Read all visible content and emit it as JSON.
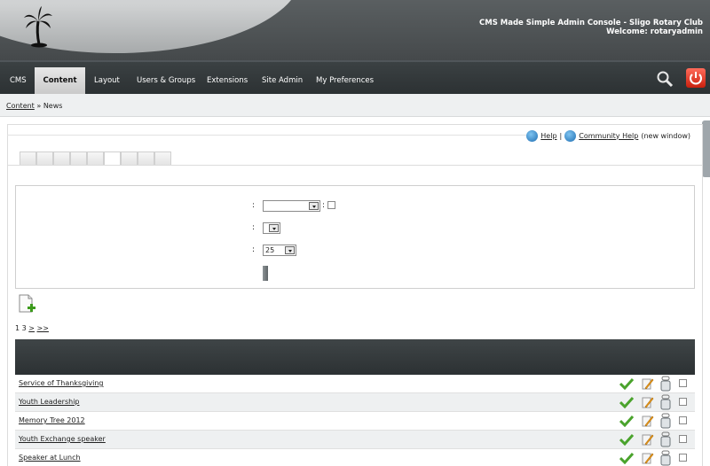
{
  "header": {
    "title_line1": "CMS Made Simple Admin Console - Sligo Rotary Club",
    "title_line2": "Welcome: rotaryadmin"
  },
  "nav": {
    "items": [
      "CMS",
      "Content",
      "Layout",
      "Users & Groups",
      "Extensions",
      "Site Admin",
      "My Preferences"
    ],
    "active": "Content"
  },
  "breadcrumb": {
    "link": "Content",
    "separator": " » ",
    "current": "News"
  },
  "help": {
    "help_label": "Help",
    "sep": " | ",
    "community_label": "Community Help",
    "suffix": "(new window)"
  },
  "filter": {
    "colon": ":",
    "category_value": "",
    "page_size_value": "25"
  },
  "pager": {
    "current": "1",
    "total": "3",
    "next": ">",
    "last": ">>"
  },
  "articles": [
    "Service of Thanksgiving",
    "Youth Leadership",
    "Memory Tree 2012",
    "Youth Exchange speaker",
    "Speaker at Lunch"
  ],
  "colors": {
    "header_bg": "#4a4f51",
    "nav_bg": "#33393b",
    "accent_red": "#d4301c",
    "check_green": "#4aa32c"
  }
}
